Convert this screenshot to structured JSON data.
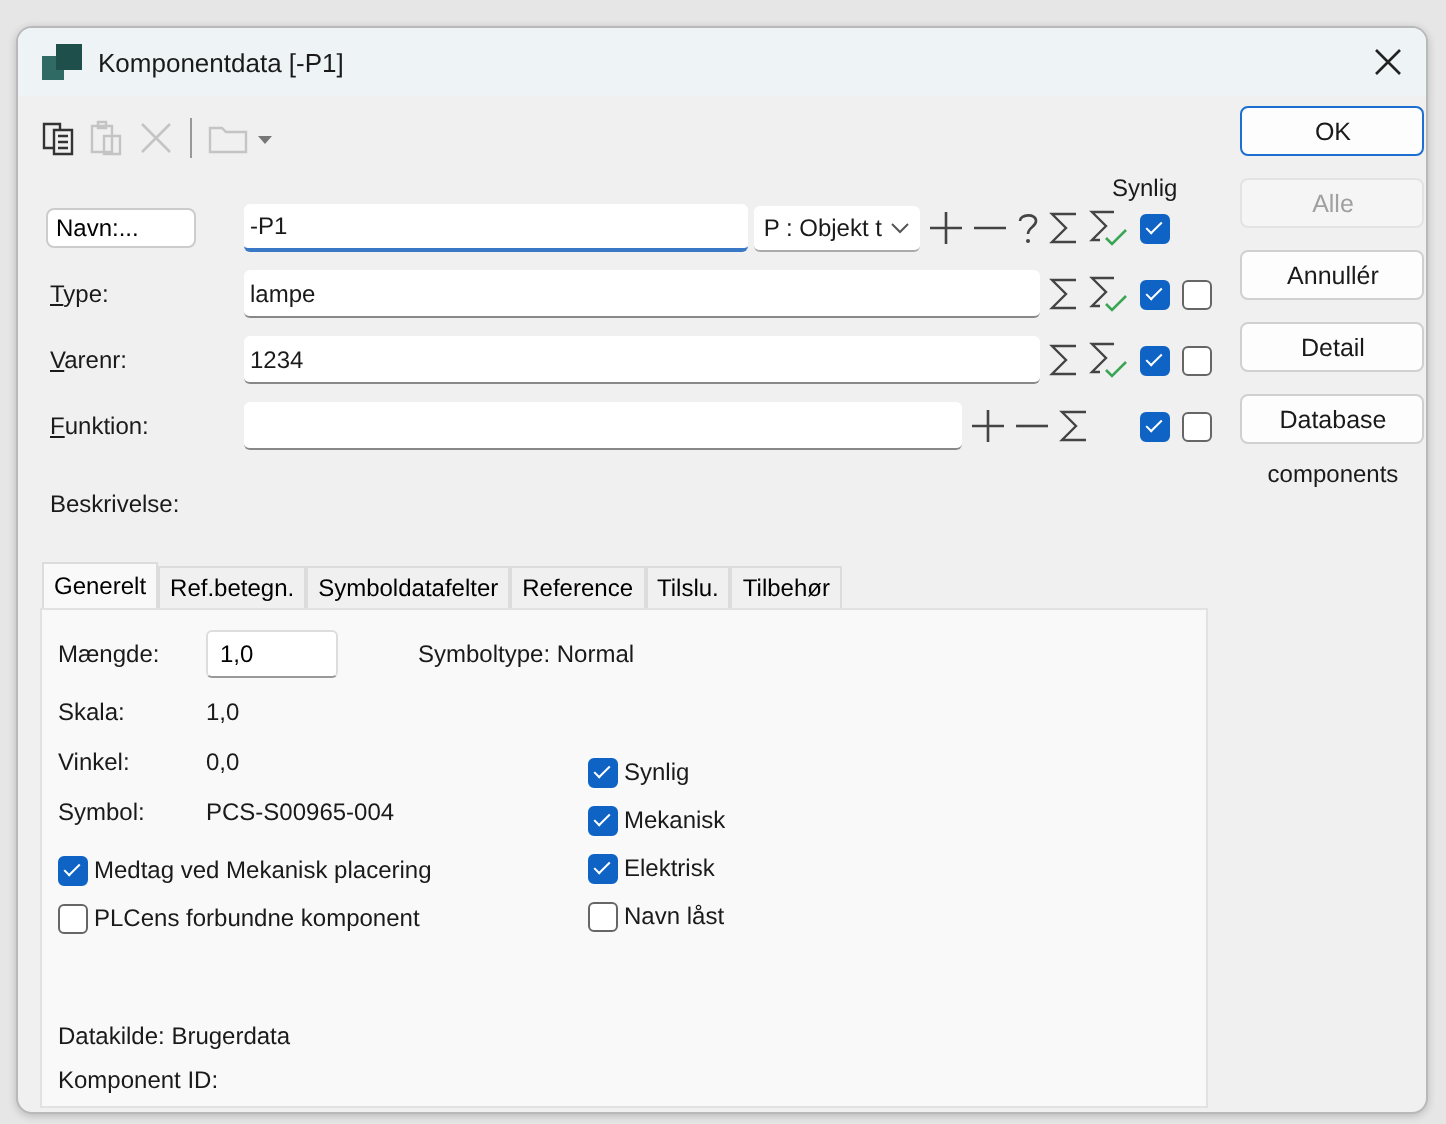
{
  "window": {
    "title": "Komponentdata [-P1]"
  },
  "toolbar": [
    {
      "kind": "copy",
      "disabled": false
    },
    {
      "kind": "paste",
      "disabled": true
    },
    {
      "kind": "delete",
      "disabled": true
    },
    {
      "kind": "folder",
      "disabled": true
    }
  ],
  "visible_header": "Synlig",
  "fields": [
    {
      "label": "Navn:...",
      "kind": "button",
      "value": "-P1",
      "focused": true,
      "dropdown": "P : Objekt t",
      "tools": [
        {
          "kind": "plus"
        },
        {
          "kind": "minus"
        },
        {
          "kind": "help"
        },
        {
          "kind": "sum"
        },
        {
          "kind": "sum-check"
        }
      ],
      "visible": true
    },
    {
      "label": "Type:",
      "kind": "label",
      "value": "lampe",
      "focused": false,
      "tools": [
        {
          "kind": "sum"
        },
        {
          "kind": "sum-check"
        }
      ],
      "visible": true,
      "option": false
    },
    {
      "label": "Varenr:",
      "kind": "label",
      "value": "1234",
      "focused": false,
      "tools": [
        {
          "kind": "sum"
        },
        {
          "kind": "sum-check"
        }
      ],
      "visible": true,
      "option": false
    },
    {
      "label": "Funktion:",
      "kind": "label",
      "focused": false,
      "tools": [
        {
          "kind": "plus"
        },
        {
          "kind": "minus"
        },
        {
          "kind": "sum"
        }
      ],
      "visible": true,
      "option": false
    }
  ],
  "description_label": "Beskrivelse:",
  "tabs": [
    {
      "label": "Generelt",
      "selected": true
    },
    {
      "label": "Ref.betegn.",
      "selected": false
    },
    {
      "label": "Symboldatafelter",
      "selected": false
    },
    {
      "label": "Reference",
      "selected": false
    },
    {
      "label": "Tilslu.",
      "selected": false
    },
    {
      "label": "Tilbehør",
      "selected": false
    }
  ],
  "general": {
    "quantity_label": "Mængde:",
    "quantity": "1,0",
    "symbol_type": "Symboltype: Normal",
    "props": [
      {
        "label": "Skala:",
        "value": "1,0"
      },
      {
        "label": "Vinkel:",
        "value": "0,0"
      },
      {
        "label": "Symbol:",
        "value": "PCS-S00965-004"
      }
    ],
    "left_checks": [
      {
        "label": "Medtag ved Mekanisk placering",
        "checked": true
      },
      {
        "label": "PLCens forbundne komponent",
        "checked": false
      }
    ],
    "right_checks": [
      {
        "label": "Synlig",
        "checked": true
      },
      {
        "label": "Mekanisk",
        "checked": true
      },
      {
        "label": "Elektrisk",
        "checked": true
      },
      {
        "label": "Navn låst",
        "checked": false
      }
    ],
    "source": "Datakilde: Brugerdata",
    "component_id": "Komponent ID:"
  },
  "buttons": [
    {
      "label": "OK",
      "default": true,
      "disabled": false
    },
    {
      "label": "Alle",
      "default": false,
      "disabled": true
    },
    {
      "label": "Annullér",
      "default": false,
      "disabled": false
    },
    {
      "label": "Detail",
      "default": false,
      "disabled": false
    },
    {
      "label": "Database",
      "default": false,
      "disabled": false
    }
  ],
  "database_note": "components"
}
